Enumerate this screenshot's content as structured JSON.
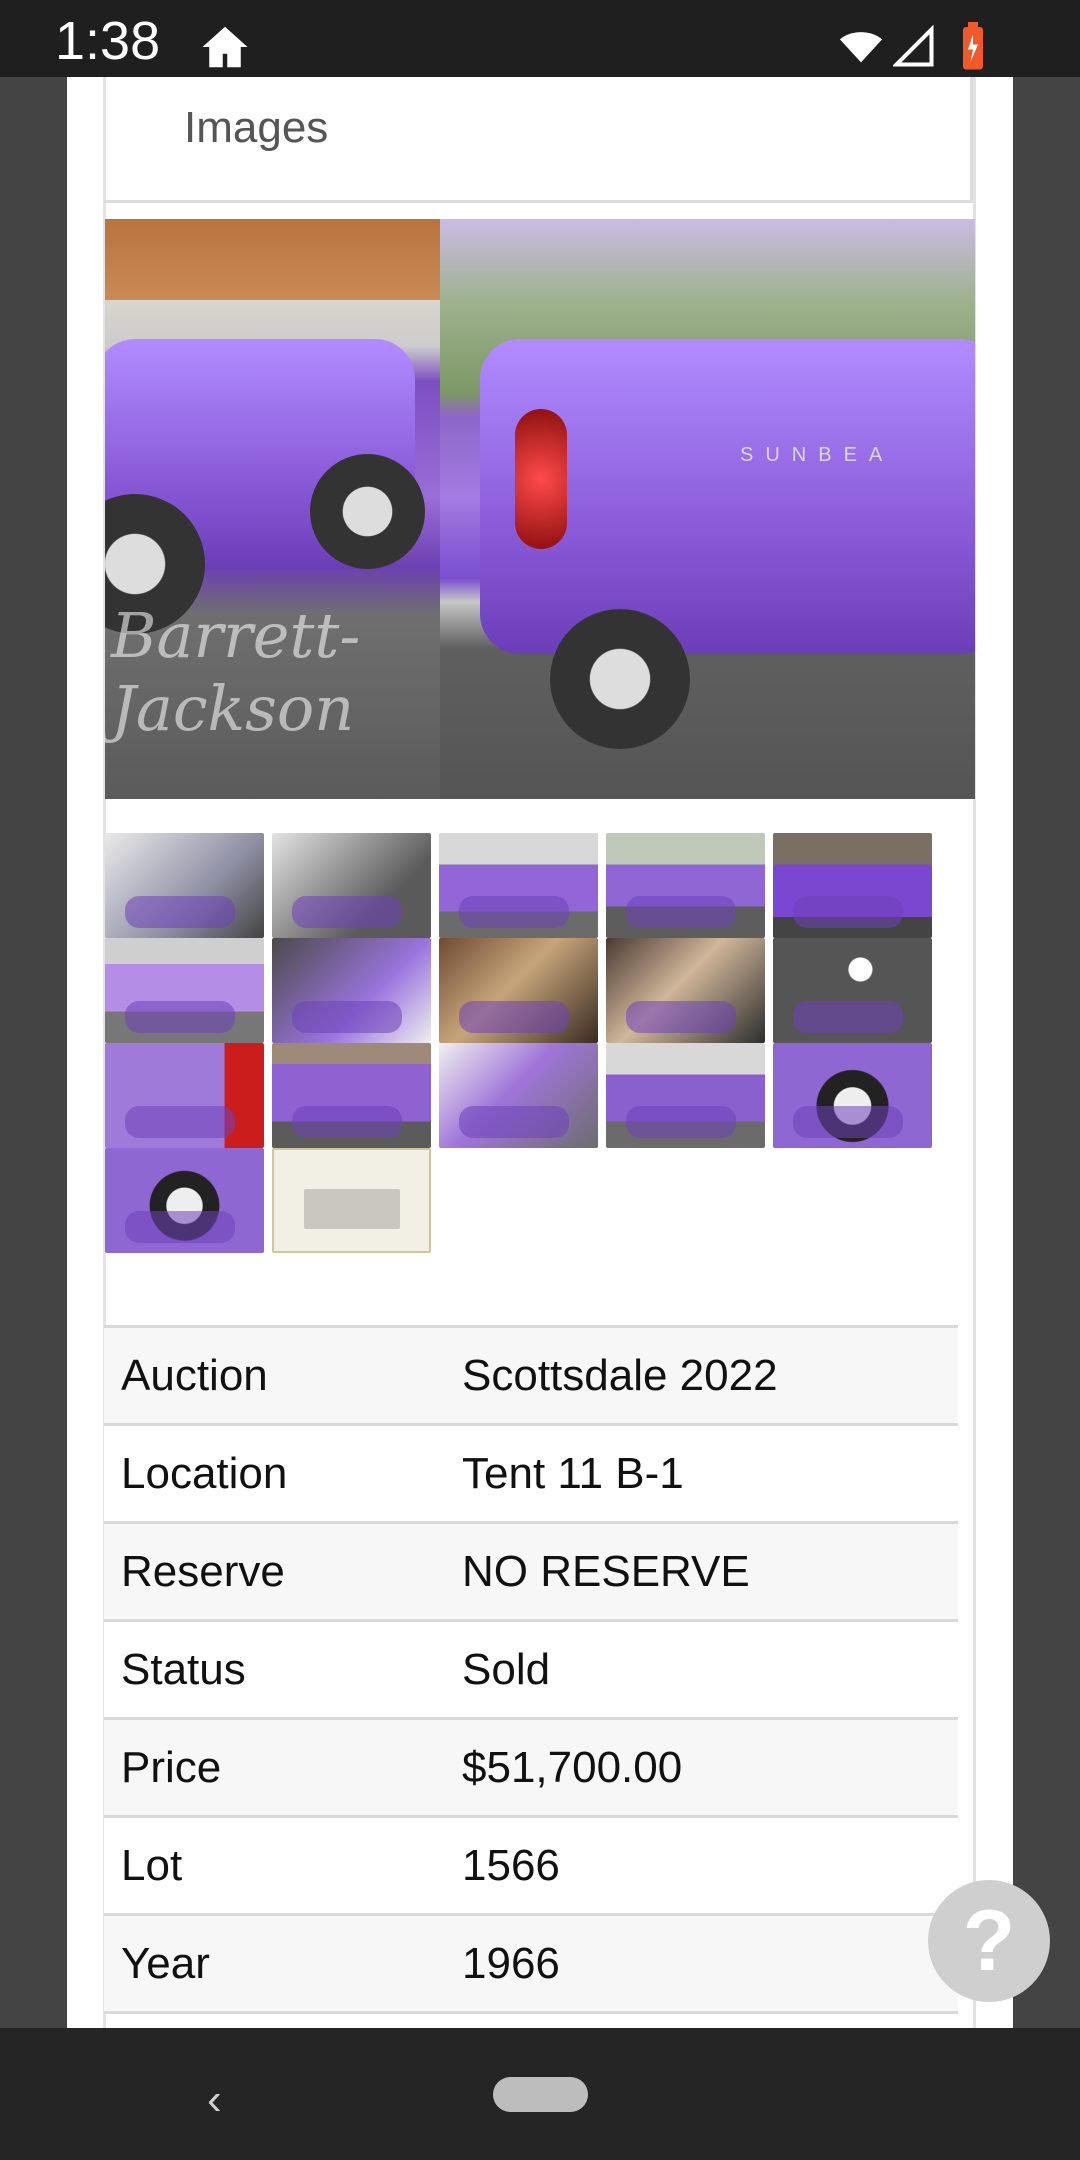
{
  "status_bar": {
    "time": "1:38",
    "icons": [
      "home-icon",
      "wifi-icon",
      "signal-icon",
      "battery-icon"
    ]
  },
  "images_section": {
    "title": "Images",
    "hero_watermark_left": "Barrett-Jackson",
    "hero_right_badge": "SUNBEA",
    "thumbnail_count": 17
  },
  "details": [
    {
      "label": "Auction",
      "value": "Scottsdale 2022"
    },
    {
      "label": "Location",
      "value": "Tent 11 B-1"
    },
    {
      "label": "Reserve",
      "value": "NO RESERVE"
    },
    {
      "label": "Status",
      "value": "Sold"
    },
    {
      "label": "Price",
      "value": "$51,700.00"
    },
    {
      "label": "Lot",
      "value": "1566"
    },
    {
      "label": "Year",
      "value": "1966"
    }
  ],
  "help_button": {
    "label": "?"
  },
  "colors": {
    "status_bar_bg": "#1f1f1f",
    "page_bg": "#ffffff",
    "gutter_bg": "#444444",
    "nav_bar_bg": "#252525",
    "help_fab_bg": "#cfcfcf",
    "car_purple": "#8a5bd9"
  }
}
